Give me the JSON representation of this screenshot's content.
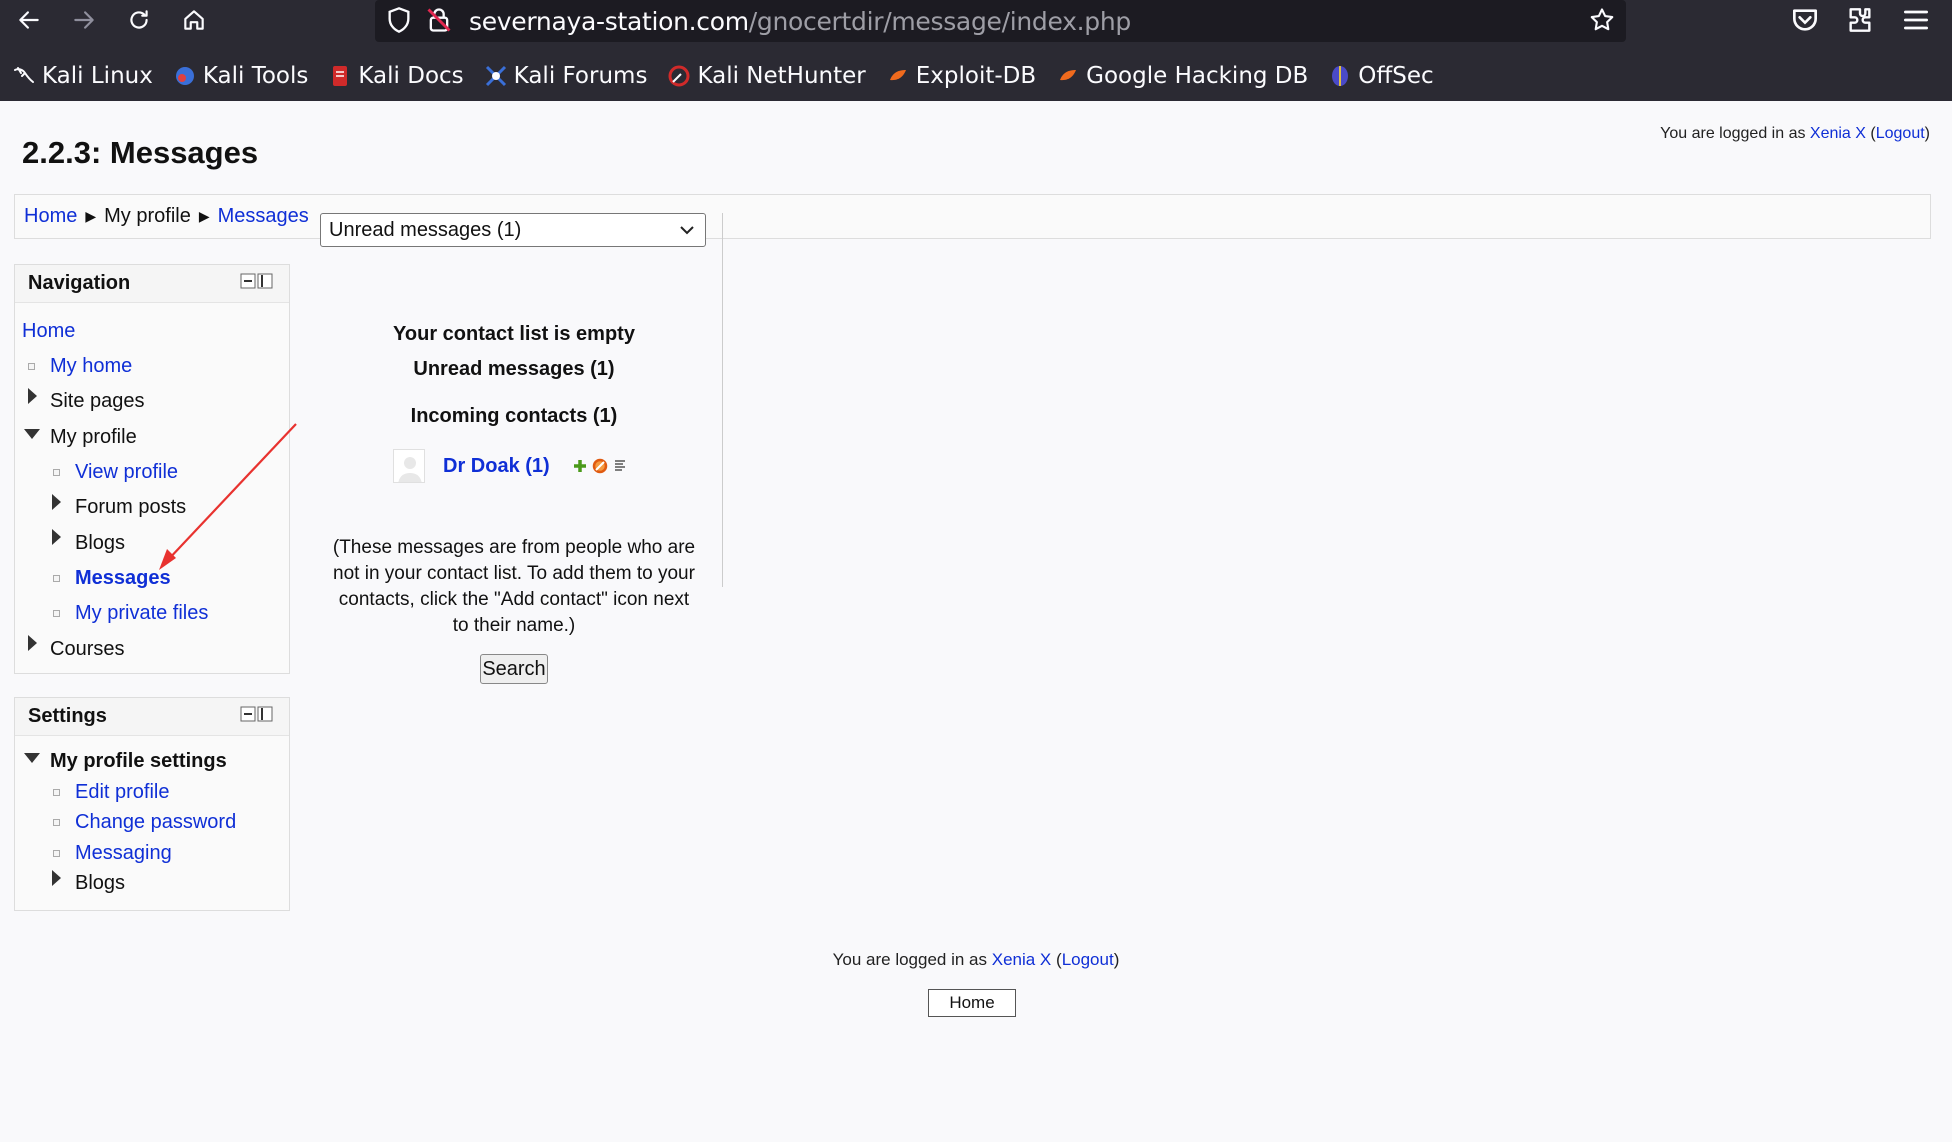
{
  "browser": {
    "url_host": "severnaya-station.com",
    "url_path": "/gnocertdir/message/index.php",
    "bookmarks": [
      {
        "label": "Kali Linux",
        "icon": "kali-dragon-icon"
      },
      {
        "label": "Kali Tools",
        "icon": "kali-tools-icon"
      },
      {
        "label": "Kali Docs",
        "icon": "kali-docs-icon"
      },
      {
        "label": "Kali Forums",
        "icon": "kali-forums-icon"
      },
      {
        "label": "Kali NetHunter",
        "icon": "kali-nethunter-icon"
      },
      {
        "label": "Exploit-DB",
        "icon": "exploit-db-icon"
      },
      {
        "label": "Google Hacking DB",
        "icon": "ghdb-icon"
      },
      {
        "label": "OffSec",
        "icon": "offsec-icon"
      }
    ]
  },
  "page": {
    "title": "2.2.3: Messages",
    "login_prefix": "You are logged in as ",
    "user": "Xenia X",
    "logout": "Logout",
    "open_paren": "(",
    "close_paren": ")"
  },
  "breadcrumb": {
    "home": "Home",
    "profile": "My profile",
    "messages": "Messages"
  },
  "navigation": {
    "title": "Navigation",
    "home": "Home",
    "my_home": "My home",
    "site_pages": "Site pages",
    "my_profile": "My profile",
    "view_profile": "View profile",
    "forum_posts": "Forum posts",
    "blogs": "Blogs",
    "messages": "Messages",
    "private_files": "My private files",
    "courses": "Courses"
  },
  "settings": {
    "title": "Settings",
    "profile_settings": "My profile settings",
    "edit_profile": "Edit profile",
    "change_password": "Change password",
    "messaging": "Messaging",
    "blogs": "Blogs"
  },
  "messages": {
    "selected": "Unread messages (1)",
    "contact_empty": "Your contact list is empty",
    "unread": "Unread messages (1)",
    "incoming": "Incoming contacts (1)",
    "contact_name": "Dr Doak (1)",
    "info": "(These messages are from people who are not in your contact list. To add them to your contacts, click the \"Add contact\" icon next to their name.)",
    "search_btn": "Search"
  },
  "footer": {
    "home_btn": "Home"
  },
  "colors": {
    "link": "#0f2fd6",
    "chrome": "#2b2a33",
    "annotation_arrow": "#e8322f"
  }
}
